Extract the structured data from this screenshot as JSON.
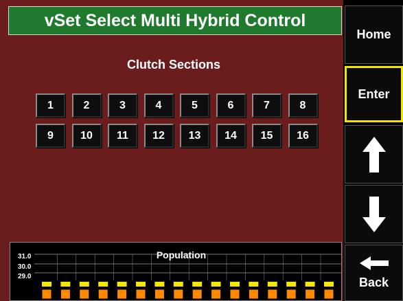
{
  "header": {
    "title": "vSet Select Multi Hybrid Control"
  },
  "clutch": {
    "heading": "Clutch Sections",
    "row1": [
      "1",
      "2",
      "3",
      "4",
      "5",
      "6",
      "7",
      "8"
    ],
    "row2": [
      "9",
      "10",
      "11",
      "12",
      "13",
      "14",
      "15",
      "16"
    ]
  },
  "population": {
    "title": "Population",
    "y_ticks": [
      "31.0",
      "30.0",
      "29.0"
    ],
    "row_count": 16,
    "colors": {
      "upper": "#f7e600",
      "lower": "#ff8a00",
      "grid": "#7a7a7a"
    }
  },
  "sidebar": {
    "home": "Home",
    "enter": "Enter",
    "back": "Back",
    "up_icon": "arrow-up-icon",
    "down_icon": "arrow-down-icon",
    "back_icon": "arrow-left-icon"
  }
}
